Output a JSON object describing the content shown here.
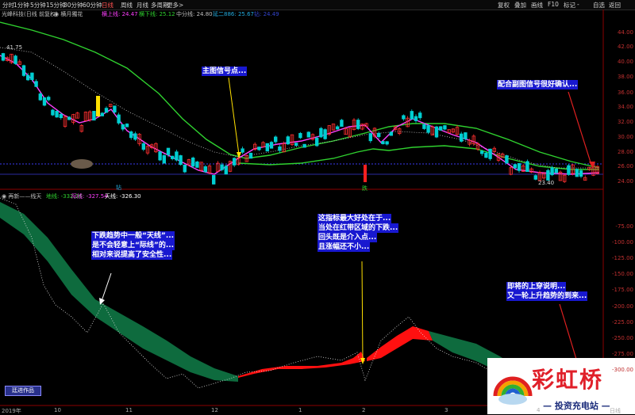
{
  "toolbar": {
    "timeframes": [
      "分时",
      "1分钟",
      "5分钟",
      "15分钟",
      "30分钟",
      "60分钟",
      "日线",
      "周线",
      "月线",
      "多周期",
      "更多>"
    ],
    "active_timeframe": "日线",
    "right_buttons": [
      "复权",
      "叠加",
      "画线",
      "F10",
      "标记",
      "-",
      "自选",
      "返回"
    ],
    "window_controls": [
      "⊟",
      "◻",
      "✕"
    ]
  },
  "main_chart": {
    "stock_title": "光峰科技(日线 前复权)",
    "indicator_name": "◉ 横月獨花",
    "upper_line": "横上线: 24.47",
    "upper_line2": "横下线: 25.12",
    "mid_line": "中分线: 24.80",
    "extra_line": "延二886: 25.67",
    "extra_line2": "钻: 24.49",
    "price_high_label": "41.75",
    "price_low_label": "23.40",
    "y_axis": [
      "44.00",
      "42.00",
      "40.00",
      "38.00",
      "36.00",
      "34.00",
      "32.00",
      "30.00",
      "28.00",
      "26.00",
      "24.00"
    ],
    "signal_labels": [
      "钻",
      "跌"
    ],
    "colors": {
      "upper_band": "#2fd12f",
      "mid": "#ff40ff",
      "candle_up": "#ff3030",
      "candle_down": "#00ced1",
      "signal": "#ffe000"
    }
  },
  "sub_chart": {
    "title": "◉ 再新——线天",
    "line1": "地线: -332.26",
    "line2": "际线: -327.54",
    "line3": "天线: -326.30",
    "y_axis": [
      "-75.00",
      "-100.00",
      "-125.00",
      "-150.00",
      "-175.00",
      "-200.00",
      "-225.00",
      "-250.00",
      "-275.00",
      "-300.00"
    ],
    "colors": {
      "green_band": "#0e6b3e",
      "red_band": "#ff1010"
    }
  },
  "annotations": {
    "main_signal": [
      "主图信号点..."
    ],
    "confirm": [
      "配合副图信号很好确认..."
    ],
    "downtrend": [
      "下跌趋势中一般“天线”...",
      "是不会轻意上“际线”的...",
      "相对来说提高了安全性..."
    ],
    "best": [
      "这指标最大好处在于...",
      "当处在红带区域的下跌...",
      "回头既是介入点...",
      "且涨幅还不小..."
    ],
    "breakout": [
      "即将的上穿说明...",
      "又一轮上升趋势的到来..."
    ]
  },
  "x_axis": [
    "2019年",
    "10",
    "11",
    "12",
    "1",
    "2",
    "3",
    "4",
    "日线"
  ],
  "work_label": "廷进作品",
  "watermark": {
    "title": "彩虹桥",
    "subtitle": "— 投资充电站 —"
  }
}
